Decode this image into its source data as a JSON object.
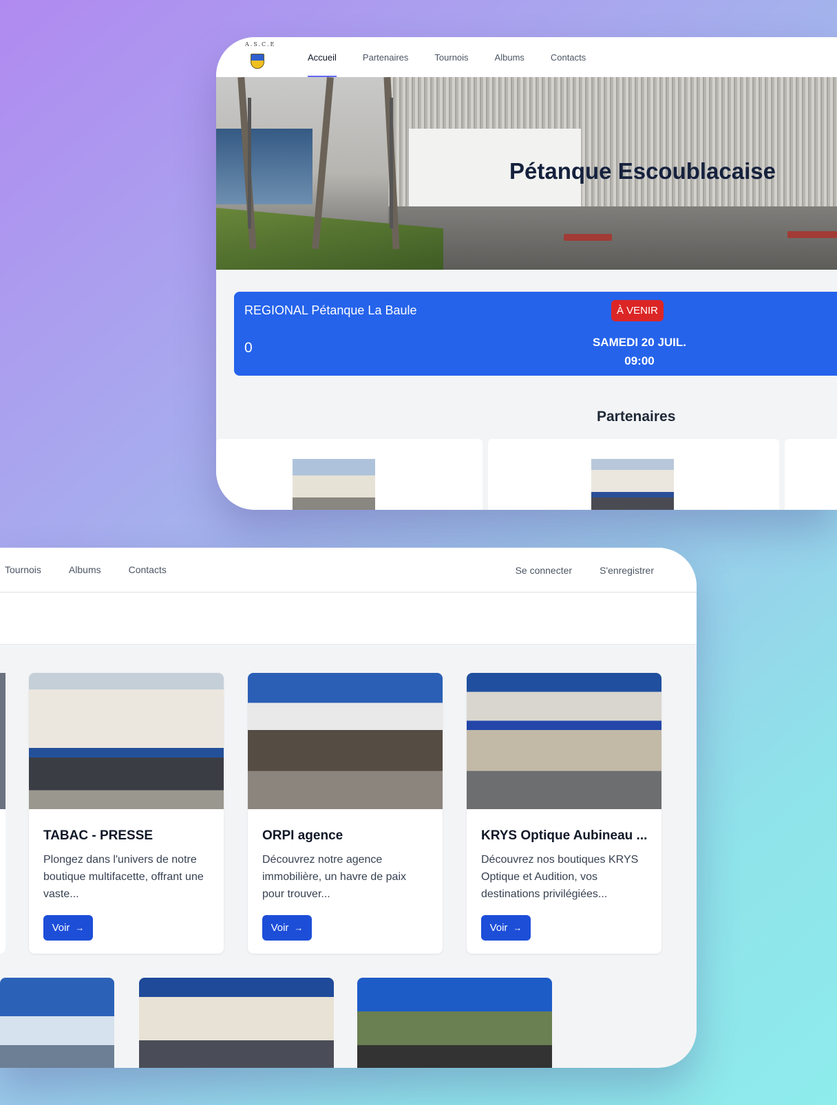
{
  "top_window": {
    "logo_text": "A.S.C.E",
    "nav": [
      "Accueil",
      "Partenaires",
      "Tournois",
      "Albums",
      "Contacts"
    ],
    "hero_title": "Pétanque Escoublacaise",
    "event": {
      "name": "REGIONAL Pétanque La Baule",
      "count": "0",
      "badge": "À VENIR",
      "date": "SAMEDI 20 JUIL.",
      "time": "09:00"
    },
    "section_title": "Partenaires"
  },
  "bottom_window": {
    "nav": [
      "Tournois",
      "Albums",
      "Contacts"
    ],
    "auth": [
      "Se connecter",
      "S'enregistrer"
    ],
    "cards": [
      {
        "title": "TABAC - PRESSE",
        "description": "Plongez dans l'univers de notre boutique multifacette, offrant une vaste...",
        "button": "Voir"
      },
      {
        "title": "ORPI agence",
        "description": "Découvrez notre agence immobilière, un havre de paix pour trouver...",
        "button": "Voir"
      },
      {
        "title": "KRYS Optique Aubineau ...",
        "description": "Découvrez nos boutiques KRYS Optique et Audition, vos destinations privilégiées...",
        "button": "Voir"
      }
    ]
  },
  "colors": {
    "primary": "#2563eb",
    "button": "#1d4ed8",
    "badge": "#dc2626",
    "nav_active_underline": "#6366f1"
  },
  "icons": [
    "arrow-right-icon"
  ]
}
